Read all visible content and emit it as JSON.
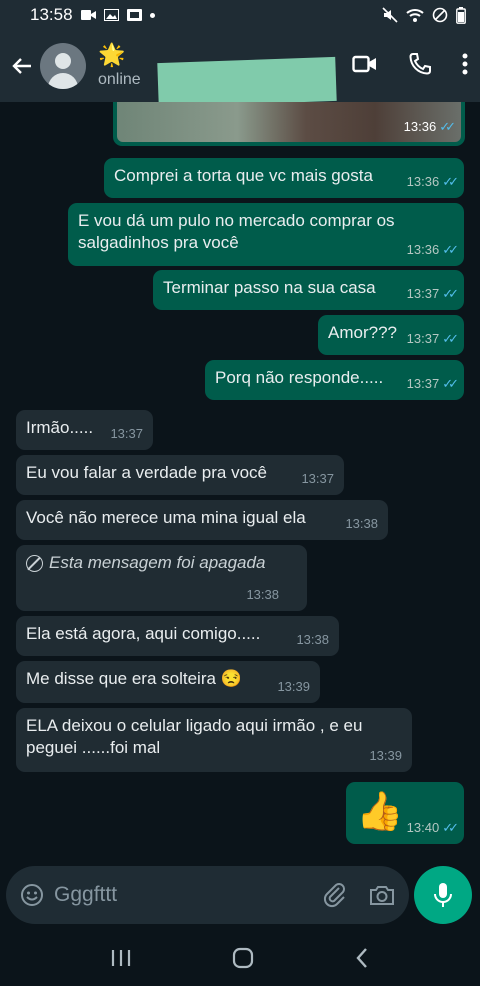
{
  "status_bar": {
    "time": "13:58"
  },
  "header": {
    "name": "🌟",
    "status": "online"
  },
  "messages": [
    {
      "text": "Comprei a torta que vc mais gosta",
      "time": "13:36"
    },
    {
      "text": "E vou dá um pulo no mercado comprar os salgadinhos pra você",
      "time": "13:36"
    },
    {
      "text": "Terminar passo na sua casa",
      "time": "13:37"
    },
    {
      "text": "Amor???",
      "time": "13:37"
    },
    {
      "text": "Porq não responde.....",
      "time": "13:37"
    },
    {
      "text": "Irmão.....",
      "time": "13:37"
    },
    {
      "text": "Eu vou falar a verdade pra você",
      "time": "13:37"
    },
    {
      "text": "Você não merece uma mina igual ela",
      "time": "13:38"
    },
    {
      "text": "Esta mensagem foi apagada",
      "time": "13:38"
    },
    {
      "text": "Ela está agora,  aqui comigo.....",
      "time": "13:38"
    },
    {
      "text": "Me disse que era solteira 😒",
      "time": "13:39"
    },
    {
      "text": "ELA deixou o celular ligado aqui irmão , e eu peguei ......foi mal",
      "time": "13:39"
    },
    {
      "text": "👍",
      "time": "13:40"
    }
  ],
  "top_image_time": "13:36",
  "input": {
    "placeholder": "Gggfttt"
  },
  "colors": {
    "outgoing": "#005c4b",
    "incoming": "#202c33",
    "accent": "#00a884",
    "read_ticks": "#53bdeb"
  }
}
